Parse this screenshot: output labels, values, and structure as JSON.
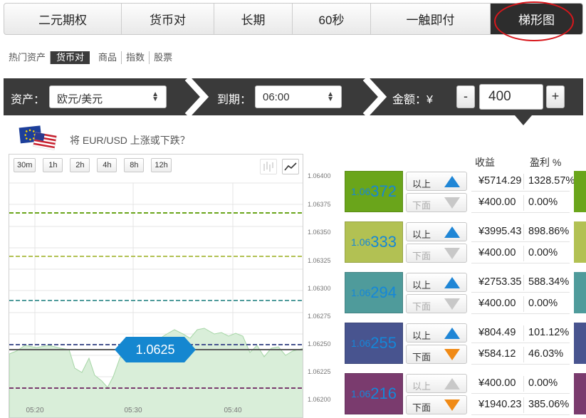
{
  "top_tabs": [
    {
      "label": "二元期权"
    },
    {
      "label": "货币对"
    },
    {
      "label": "长期"
    },
    {
      "label": "60秒"
    },
    {
      "label": "一触即付"
    },
    {
      "label": "梯形图",
      "active": true
    }
  ],
  "categories": [
    {
      "label": "热门资产"
    },
    {
      "label": "货币对",
      "active": true
    },
    {
      "label": "商品"
    },
    {
      "label": "指数"
    },
    {
      "label": "股票"
    }
  ],
  "toolbar": {
    "asset_label": "资产：",
    "asset_value": "欧元/美元",
    "expiry_label": "到期：",
    "expiry_value": "06:00",
    "amount_label": "金额：¥",
    "amount_value": "400",
    "minus": "-",
    "plus": "+"
  },
  "question": "将 EUR/USD 上涨或下跌？",
  "columns": {
    "payout": "收益",
    "profit": "盈利 %"
  },
  "chart": {
    "timeframes": [
      "30m",
      "1h",
      "2h",
      "4h",
      "8h",
      "12h"
    ],
    "current_price": "1.0625",
    "y_ticks": [
      "1.06400",
      "1.06375",
      "1.06350",
      "1.06325",
      "1.06300",
      "1.06275",
      "1.06250",
      "1.06225",
      "1.06200"
    ],
    "x_ticks": [
      "05:20",
      "05:30",
      "05:40"
    ]
  },
  "ladder": [
    {
      "level_small": "1.06",
      "level_large": "372",
      "color": "#6aa51b",
      "above": {
        "label": "以上",
        "active": true,
        "payout": "¥5714.29",
        "profit": "1328.57%"
      },
      "below": {
        "label": "下面",
        "active": false,
        "payout": "¥400.00",
        "profit": "0.00%"
      }
    },
    {
      "level_small": "1.06",
      "level_large": "333",
      "color": "#b2c153",
      "above": {
        "label": "以上",
        "active": true,
        "payout": "¥3995.43",
        "profit": "898.86%"
      },
      "below": {
        "label": "下面",
        "active": false,
        "payout": "¥400.00",
        "profit": "0.00%"
      }
    },
    {
      "level_small": "1.06",
      "level_large": "294",
      "color": "#4f9b9b",
      "above": {
        "label": "以上",
        "active": true,
        "payout": "¥2753.35",
        "profit": "588.34%"
      },
      "below": {
        "label": "下面",
        "active": false,
        "payout": "¥400.00",
        "profit": "0.00%"
      }
    },
    {
      "level_small": "1.06",
      "level_large": "255",
      "color": "#48548f",
      "above": {
        "label": "以上",
        "active": true,
        "payout": "¥804.49",
        "profit": "101.12%"
      },
      "below": {
        "label": "下面",
        "active": true,
        "payout": "¥584.12",
        "profit": "46.03%"
      }
    },
    {
      "level_small": "1.06",
      "level_large": "216",
      "color": "#7a3b6e",
      "above": {
        "label": "以上",
        "active": false,
        "payout": "¥400.00",
        "profit": "0.00%"
      },
      "below": {
        "label": "下面",
        "active": true,
        "payout": "¥1940.23",
        "profit": "385.06%"
      }
    }
  ],
  "colors": {
    "up_arrow": "#1f86d6",
    "down_arrow": "#f08a16",
    "inactive_arrow": "#c8c8c8",
    "highlight_ring": "#d8171c"
  }
}
